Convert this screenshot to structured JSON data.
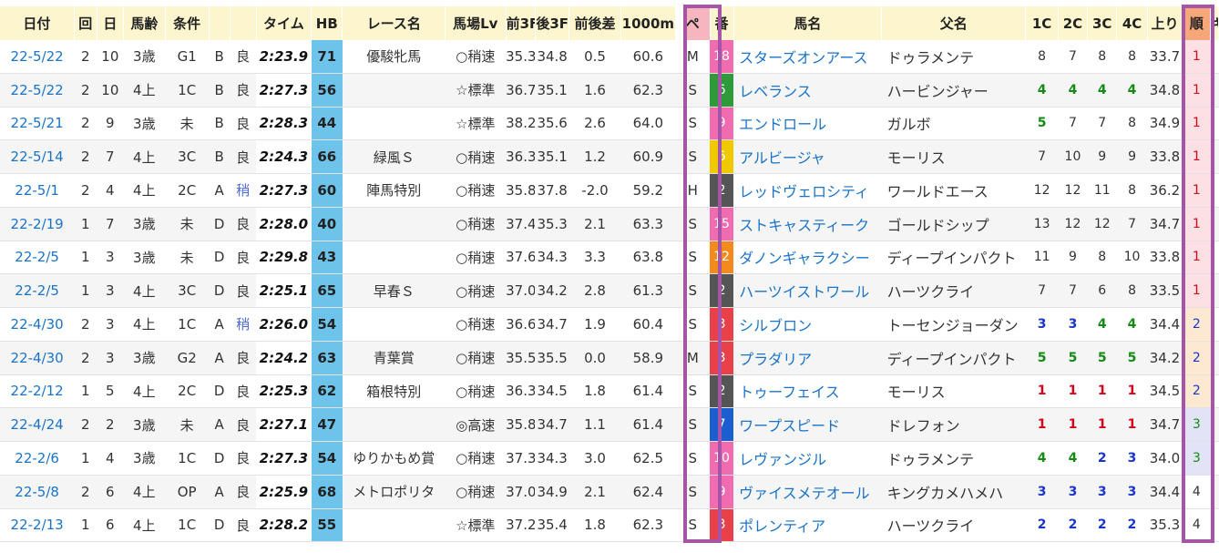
{
  "headers": [
    "日付",
    "回",
    "日",
    "馬齢",
    "条件",
    "",
    "",
    "タイム",
    "HB",
    "レース名",
    "馬場Lv",
    "前3F",
    "後3F",
    "前後差",
    "1000m",
    "ペ",
    "番",
    "馬名",
    "父名",
    "1C",
    "2C",
    "3C",
    "4C",
    "上り",
    "順",
    "キ"
  ],
  "colors": {
    "header_bg": "#fcf5ce",
    "hb_bg": "#6ec3ea",
    "link": "#1a73c7",
    "highlight_border": "#a654a8",
    "rank1_bg": "#fde0e3",
    "rank2_bg": "#fde8d2",
    "rank3_bg": "#e3e3f7"
  },
  "rows": [
    {
      "date": "22-5/22",
      "kai": "2",
      "nichi": "10",
      "age": "3歳",
      "cond": "G1",
      "cls": "B",
      "baba": "良",
      "time": "2:23.9",
      "hb": "71",
      "race": "優駿牝馬",
      "lv": "○稍速",
      "f3": "35.3",
      "l3": "34.8",
      "diff": "0.5",
      "m1000": "60.6",
      "pace": "M",
      "num": "18",
      "num_color": "#f06bb0",
      "horse": "スターズオンアース",
      "sire": "ドゥラメンテ",
      "c1": "8",
      "c2": "7",
      "c3": "8",
      "c4": "8",
      "cc1": "plain",
      "cc2": "plain",
      "cc3": "plain",
      "cc4": "plain",
      "agari": "33.7",
      "rank": "1"
    },
    {
      "date": "22-5/22",
      "kai": "2",
      "nichi": "10",
      "age": "4上",
      "cond": "1C",
      "cls": "B",
      "baba": "良",
      "time": "2:27.3",
      "hb": "56",
      "race": "",
      "lv": "☆標準",
      "f3": "36.7",
      "l3": "35.1",
      "diff": "1.6",
      "m1000": "62.3",
      "pace": "S",
      "num": "6",
      "num_color": "#2e9a3a",
      "horse": "レベランス",
      "sire": "ハービンジャー",
      "c1": "4",
      "c2": "4",
      "c3": "4",
      "c4": "4",
      "cc1": "green",
      "cc2": "green",
      "cc3": "green",
      "cc4": "green",
      "agari": "34.8",
      "rank": "1"
    },
    {
      "date": "22-5/21",
      "kai": "2",
      "nichi": "9",
      "age": "3歳",
      "cond": "未",
      "cls": "B",
      "baba": "良",
      "time": "2:28.3",
      "hb": "44",
      "race": "",
      "lv": "☆標準",
      "f3": "38.2",
      "l3": "35.6",
      "diff": "2.6",
      "m1000": "64.0",
      "pace": "S",
      "num": "9",
      "num_color": "#f06bb0",
      "horse": "エンドロール",
      "sire": "ガルボ",
      "c1": "5",
      "c2": "7",
      "c3": "7",
      "c4": "8",
      "cc1": "green",
      "cc2": "plain",
      "cc3": "plain",
      "cc4": "plain",
      "agari": "34.9",
      "rank": "1"
    },
    {
      "date": "22-5/14",
      "kai": "2",
      "nichi": "7",
      "age": "4上",
      "cond": "3C",
      "cls": "B",
      "baba": "良",
      "time": "2:24.3",
      "hb": "66",
      "race": "緑風Ｓ",
      "lv": "○稍速",
      "f3": "36.3",
      "l3": "35.1",
      "diff": "1.2",
      "m1000": "60.9",
      "pace": "S",
      "num": "6",
      "num_color": "#f0c800",
      "horse": "アルビージャ",
      "sire": "モーリス",
      "c1": "7",
      "c2": "10",
      "c3": "9",
      "c4": "9",
      "cc1": "plain",
      "cc2": "plain",
      "cc3": "plain",
      "cc4": "plain",
      "agari": "33.8",
      "rank": "1"
    },
    {
      "date": "22-5/1",
      "kai": "2",
      "nichi": "4",
      "age": "4上",
      "cond": "2C",
      "cls": "A",
      "baba": "稍",
      "time": "2:27.3",
      "hb": "60",
      "race": "陣馬特別",
      "lv": "○稍速",
      "f3": "35.8",
      "l3": "37.8",
      "diff": "-2.0",
      "m1000": "59.2",
      "pace": "H",
      "num": "2",
      "num_color": "#555555",
      "horse": "レッドヴェロシティ",
      "sire": "ワールドエース",
      "c1": "12",
      "c2": "12",
      "c3": "11",
      "c4": "8",
      "cc1": "plain",
      "cc2": "plain",
      "cc3": "plain",
      "cc4": "plain",
      "agari": "36.2",
      "rank": "1"
    },
    {
      "date": "22-2/19",
      "kai": "1",
      "nichi": "7",
      "age": "3歳",
      "cond": "未",
      "cls": "D",
      "baba": "良",
      "time": "2:28.0",
      "hb": "40",
      "race": "",
      "lv": "○稍速",
      "f3": "37.4",
      "l3": "35.3",
      "diff": "2.1",
      "m1000": "63.3",
      "pace": "S",
      "num": "15",
      "num_color": "#f06bb0",
      "horse": "ストキャスティーク",
      "sire": "ゴールドシップ",
      "c1": "13",
      "c2": "12",
      "c3": "12",
      "c4": "7",
      "cc1": "plain",
      "cc2": "plain",
      "cc3": "plain",
      "cc4": "plain",
      "agari": "34.7",
      "rank": "1"
    },
    {
      "date": "22-2/5",
      "kai": "1",
      "nichi": "3",
      "age": "3歳",
      "cond": "未",
      "cls": "D",
      "baba": "良",
      "time": "2:29.8",
      "hb": "43",
      "race": "",
      "lv": "○稍速",
      "f3": "37.6",
      "l3": "34.3",
      "diff": "3.3",
      "m1000": "63.8",
      "pace": "S",
      "num": "12",
      "num_color": "#f38a1e",
      "horse": "ダノンギャラクシー",
      "sire": "ディープインパクト",
      "c1": "11",
      "c2": "9",
      "c3": "8",
      "c4": "10",
      "cc1": "plain",
      "cc2": "plain",
      "cc3": "plain",
      "cc4": "plain",
      "agari": "33.8",
      "rank": "1"
    },
    {
      "date": "22-2/5",
      "kai": "1",
      "nichi": "3",
      "age": "4上",
      "cond": "3C",
      "cls": "D",
      "baba": "良",
      "time": "2:25.1",
      "hb": "65",
      "race": "早春Ｓ",
      "lv": "○稍速",
      "f3": "37.0",
      "l3": "34.2",
      "diff": "2.8",
      "m1000": "61.3",
      "pace": "S",
      "num": "2",
      "num_color": "#555555",
      "horse": "ハーツイストワール",
      "sire": "ハーツクライ",
      "c1": "7",
      "c2": "7",
      "c3": "6",
      "c4": "8",
      "cc1": "plain",
      "cc2": "plain",
      "cc3": "plain",
      "cc4": "plain",
      "agari": "33.5",
      "rank": "1"
    },
    {
      "date": "22-4/30",
      "kai": "2",
      "nichi": "3",
      "age": "4上",
      "cond": "1C",
      "cls": "A",
      "baba": "稍",
      "time": "2:26.0",
      "hb": "54",
      "race": "",
      "lv": "○稍速",
      "f3": "36.6",
      "l3": "34.7",
      "diff": "1.9",
      "m1000": "60.4",
      "pace": "S",
      "num": "3",
      "num_color": "#e8414a",
      "horse": "シルブロン",
      "sire": "トーセンジョーダン",
      "c1": "3",
      "c2": "3",
      "c3": "4",
      "c4": "4",
      "cc1": "blue",
      "cc2": "blue",
      "cc3": "green",
      "cc4": "green",
      "agari": "34.4",
      "rank": "2"
    },
    {
      "date": "22-4/30",
      "kai": "2",
      "nichi": "3",
      "age": "3歳",
      "cond": "G2",
      "cls": "A",
      "baba": "良",
      "time": "2:24.2",
      "hb": "63",
      "race": "青葉賞",
      "lv": "○稍速",
      "f3": "35.5",
      "l3": "35.5",
      "diff": "0.0",
      "m1000": "58.9",
      "pace": "M",
      "num": "3",
      "num_color": "#e8414a",
      "horse": "プラダリア",
      "sire": "ディープインパクト",
      "c1": "5",
      "c2": "5",
      "c3": "5",
      "c4": "5",
      "cc1": "green",
      "cc2": "green",
      "cc3": "green",
      "cc4": "green",
      "agari": "34.2",
      "rank": "2"
    },
    {
      "date": "22-2/12",
      "kai": "1",
      "nichi": "5",
      "age": "4上",
      "cond": "2C",
      "cls": "D",
      "baba": "良",
      "time": "2:25.3",
      "hb": "62",
      "race": "箱根特別",
      "lv": "○稍速",
      "f3": "36.3",
      "l3": "34.5",
      "diff": "1.8",
      "m1000": "61.4",
      "pace": "S",
      "num": "2",
      "num_color": "#555555",
      "horse": "トゥーフェイス",
      "sire": "モーリス",
      "c1": "1",
      "c2": "1",
      "c3": "1",
      "c4": "1",
      "cc1": "red",
      "cc2": "red",
      "cc3": "red",
      "cc4": "red",
      "agari": "34.5",
      "rank": "2"
    },
    {
      "date": "22-4/24",
      "kai": "2",
      "nichi": "2",
      "age": "3歳",
      "cond": "未",
      "cls": "A",
      "baba": "良",
      "time": "2:27.1",
      "hb": "47",
      "race": "",
      "lv": "◎高速",
      "f3": "35.8",
      "l3": "34.7",
      "diff": "1.1",
      "m1000": "61.4",
      "pace": "S",
      "num": "7",
      "num_color": "#1a5fd0",
      "horse": "ワープスピード",
      "sire": "ドレフォン",
      "c1": "1",
      "c2": "1",
      "c3": "1",
      "c4": "1",
      "cc1": "red",
      "cc2": "red",
      "cc3": "red",
      "cc4": "red",
      "agari": "34.7",
      "rank": "3"
    },
    {
      "date": "22-2/6",
      "kai": "1",
      "nichi": "4",
      "age": "3歳",
      "cond": "1C",
      "cls": "D",
      "baba": "良",
      "time": "2:27.3",
      "hb": "54",
      "race": "ゆりかもめ賞",
      "lv": "○稍速",
      "f3": "37.3",
      "l3": "34.3",
      "diff": "3.0",
      "m1000": "62.5",
      "pace": "S",
      "num": "10",
      "num_color": "#f06bb0",
      "horse": "レヴァンジル",
      "sire": "ドゥラメンテ",
      "c1": "4",
      "c2": "4",
      "c3": "2",
      "c4": "3",
      "cc1": "green",
      "cc2": "green",
      "cc3": "blue",
      "cc4": "blue",
      "agari": "34.0",
      "rank": "3"
    },
    {
      "date": "22-5/8",
      "kai": "2",
      "nichi": "6",
      "age": "4上",
      "cond": "OP",
      "cls": "A",
      "baba": "良",
      "time": "2:25.9",
      "hb": "68",
      "race": "メトロポリタ",
      "lv": "○稍速",
      "f3": "37.0",
      "l3": "34.9",
      "diff": "2.1",
      "m1000": "62.4",
      "pace": "S",
      "num": "9",
      "num_color": "#f06bb0",
      "horse": "ヴァイスメテオール",
      "sire": "キングカメハメハ",
      "c1": "3",
      "c2": "3",
      "c3": "3",
      "c4": "3",
      "cc1": "blue",
      "cc2": "blue",
      "cc3": "blue",
      "cc4": "blue",
      "agari": "34.4",
      "rank": "4"
    },
    {
      "date": "22-2/13",
      "kai": "1",
      "nichi": "6",
      "age": "4上",
      "cond": "1C",
      "cls": "D",
      "baba": "良",
      "time": "2:28.2",
      "hb": "55",
      "race": "",
      "lv": "☆標準",
      "f3": "37.2",
      "l3": "35.4",
      "diff": "1.8",
      "m1000": "62.3",
      "pace": "S",
      "num": "3",
      "num_color": "#e8414a",
      "horse": "ポレンティア",
      "sire": "ハーツクライ",
      "c1": "2",
      "c2": "2",
      "c3": "2",
      "c4": "2",
      "cc1": "blue",
      "cc2": "blue",
      "cc3": "blue",
      "cc4": "blue",
      "agari": "35.3",
      "rank": "4"
    }
  ]
}
